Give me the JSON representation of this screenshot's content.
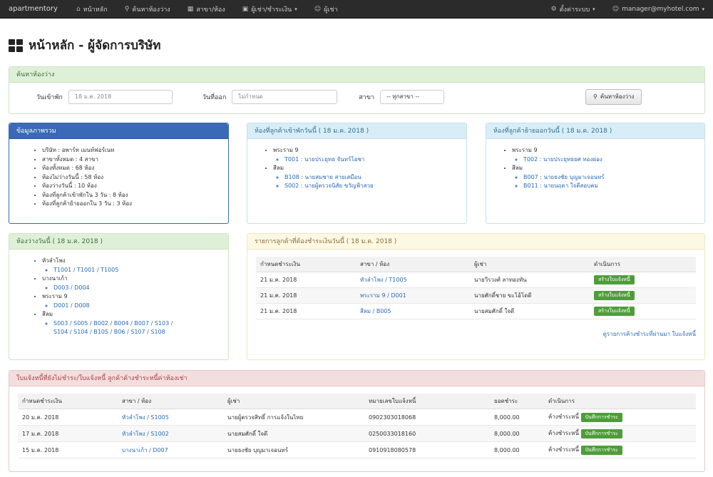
{
  "navbar": {
    "brand": "apartmentory",
    "items": [
      {
        "icon": "home-icon",
        "glyph": "⌂",
        "label": "หน้าหลัก"
      },
      {
        "icon": "search-icon",
        "glyph": "⚲",
        "label": "ค้นหาห้องว่าง"
      },
      {
        "icon": "building-icon",
        "glyph": "▦",
        "label": "สาขา/ห้อง"
      },
      {
        "icon": "money-icon",
        "glyph": "▣",
        "label": "ผู้เช่า/ชำระเงิน"
      },
      {
        "icon": "user-icon",
        "glyph": "☺",
        "label": "ผู้เช่า"
      }
    ],
    "right": [
      {
        "icon": "settings-icon",
        "glyph": "⚙",
        "label": "ตั้งค่าระบบ"
      },
      {
        "icon": "user-icon",
        "glyph": "☺",
        "label": "manager@myhotel.com"
      }
    ]
  },
  "page": {
    "title": "หน้าหลัก - ผู้จัดการบริษัท"
  },
  "search": {
    "header": "ค้นหาห้องว่าง",
    "checkin_label": "วันเข้าพัก",
    "checkin_value": "18 ม.ค. 2018",
    "checkout_label": "วันที่ออก",
    "checkout_placeholder": "ไม่กำหนด",
    "branch_label": "สาขา",
    "branch_value": "-- ทุกสาขา --",
    "button": "ค้นหาห้องว่าง"
  },
  "summary": {
    "header": "ข้อมูลภาพรวม",
    "items": [
      "บริษัท : อพาร์ท เมนท์ฟอร์เนท",
      "สาขาทั้งหมด : 4 สาขา",
      "ห้องทั้งหมด : 68 ห้อง",
      "ห้องไม่ว่างวันนี้ : 58 ห้อง",
      "ห้องว่างวันนี้ : 10 ห้อง",
      "ห้องที่ลูกค้าเข้าพักใน 3 วัน : 8 ห้อง",
      "ห้องที่ลูกค้าย้ายออกใน 3 วัน : 3 ห้อง"
    ]
  },
  "checkin_today": {
    "header": "ห้องที่ลูกค้าเข้าพักวันนี้ ( 18 ม.ค. 2018 )",
    "groups": [
      {
        "name": "พระราม 9",
        "rows": [
          "T001 : นายประยุทธ จันทร์โอชา"
        ]
      },
      {
        "name": "สีลม",
        "rows": [
          "B108 : นายสมชาย สายเสมือน",
          "S002 : นายผู้ตรวจนิสัย ขวัญฟ้าสวย"
        ]
      }
    ]
  },
  "checkout_today": {
    "header": "ห้องที่ลูกค้าย้ายออกวันนี้ ( 18 ม.ค. 2018 )",
    "groups": [
      {
        "name": "พระราม 9",
        "rows": [
          "T002 : นายประยุทธยศ ทองผ่อง"
        ]
      },
      {
        "name": "สีลม",
        "rows": [
          "B007 : นายธงชัย บุญมาเจอนทร์",
          "B011 : นายนฤดา ใจดีสอบคม"
        ]
      }
    ]
  },
  "vacant_today": {
    "header": "ห้องว่างวันนี้ ( 18 ม.ค. 2018 )",
    "groups": [
      {
        "name": "หัวลำโพง",
        "rooms": "T1001 / T1001 / T1005"
      },
      {
        "name": "บางนาเก้า",
        "rooms": "D003 / D004"
      },
      {
        "name": "พระราม 9",
        "rooms": "D001 / D008"
      },
      {
        "name": "สีลม",
        "rooms": "S003 / S005 / B002 / B004 / B007 / S103 / S104 / S104 / B105 / B06 / S107 / S108"
      }
    ]
  },
  "billing_today": {
    "header": "รายการลูกค้าที่ต้องชำระเงินวันนี้ ( 18 ม.ค. 2018 )",
    "columns": [
      "กำหนดชำระเงิน",
      "สาขา / ห้อง",
      "ผู้เช่า",
      "ดำเนินการ"
    ],
    "rows": [
      {
        "date": "21 ม.ค. 2018",
        "room": "หัวลำโพง / T1005",
        "tenant": "นายวีรวงศ์ ลาทองทัน",
        "action": "สร้างใบแจ้งหนี้"
      },
      {
        "date": "21 ม.ค. 2018",
        "room": "พระราม 9 / D001",
        "tenant": "นายศักดิ์ชาย ขะโอ้โดดี",
        "action": "สร้างใบแจ้งหนี้"
      },
      {
        "date": "21 ม.ค. 2018",
        "room": "สีลม / B005",
        "tenant": "นายสมศักดิ์ ใจดี",
        "action": "สร้างใบแจ้งหนี้"
      }
    ],
    "more_link": "ดูรายการค้างชำระที่ผ่านมา ใบแจ้งหนี้"
  },
  "overdue": {
    "header": "ใบแจ้งหนี้ที่ยังไม่ชำระ/ใบแจ้งหนี้ ลูกค้าค้างชำระหนี้ค่าห้องเช่า",
    "columns": [
      "กำหนดชำระเงิน",
      "สาขา / ห้อง",
      "ผู้เช่า",
      "หมายเลขใบแจ้งหนี้",
      "ยอดชำระ",
      "ดำเนินการ"
    ],
    "rows": [
      {
        "date": "20 ม.ค. 2018",
        "room": "หัวลำโพง / S1005",
        "tenant": "นายผู้ตรวจสิทธิ์ การแจ้งในไทย",
        "invoice": "0902303018068",
        "amount": "8,000.00",
        "status": "ค้างชำระหนี้",
        "action": "บันทึกการชำระ"
      },
      {
        "date": "17 ม.ค. 2018",
        "room": "หัวลำโพง / S1002",
        "tenant": "นายสมศักดิ์ ใจดี",
        "invoice": "0250033018160",
        "amount": "8,000.00",
        "status": "ค้างชำระหนี้",
        "action": "บันทึกการชำระ"
      },
      {
        "date": "15 ม.ค. 2018",
        "room": "บางนาเก้า / D007",
        "tenant": "นายธงชัย บุญมาเจอนทร์",
        "invoice": "0910918080578",
        "amount": "8,000.00",
        "status": "ค้างชำระหนี้",
        "action": "บันทึกการชำระ"
      }
    ]
  }
}
